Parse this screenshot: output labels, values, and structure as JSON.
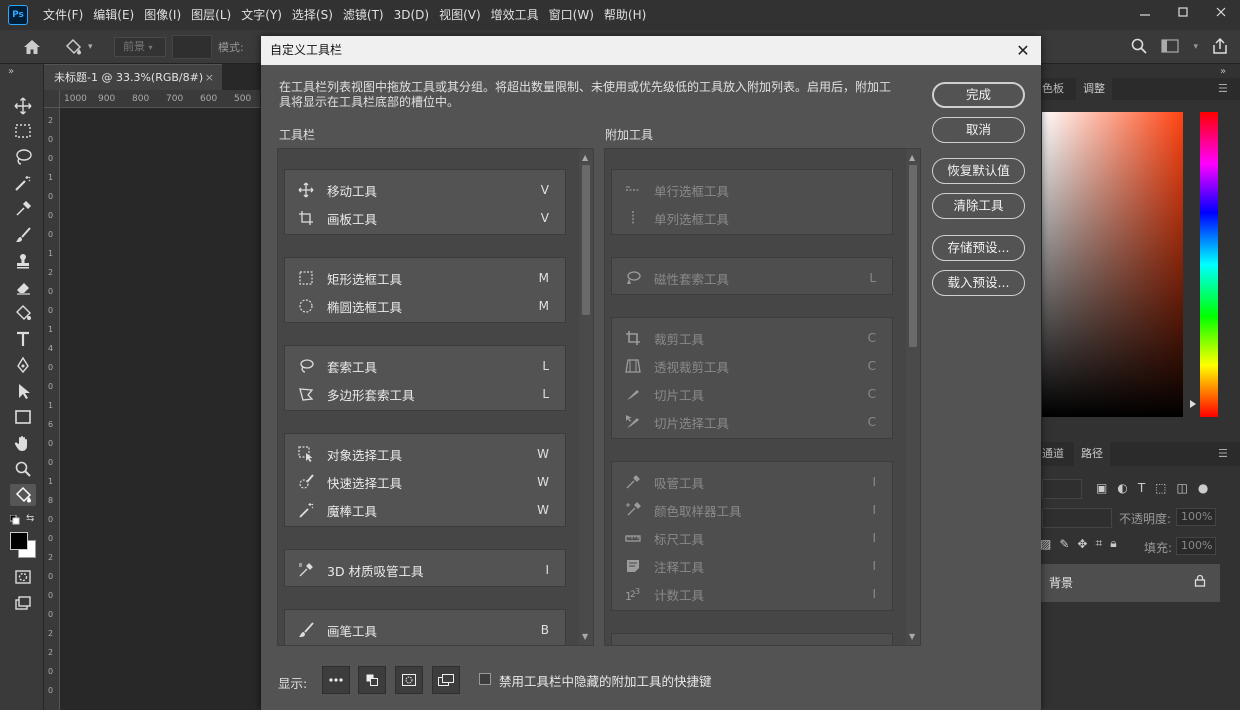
{
  "app": {
    "logo": "Ps",
    "menu": [
      "文件(F)",
      "编辑(E)",
      "图像(I)",
      "图层(L)",
      "文字(Y)",
      "选择(S)",
      "滤镜(T)",
      "3D(D)",
      "视图(V)",
      "增效工具",
      "窗口(W)",
      "帮助(H)"
    ]
  },
  "options_bar": {
    "fill_source": "前景",
    "mode_label": "模式:"
  },
  "document": {
    "tab_title": "未标题-1 @ 33.3%(RGB/8#)",
    "ruler_ticks": [
      "1000",
      "900",
      "800",
      "700",
      "600",
      "500"
    ],
    "vruler_ticks": [
      "2",
      "0",
      "0",
      "1",
      "0",
      "0",
      "0",
      "1",
      "2",
      "0",
      "0",
      "1",
      "4",
      "0",
      "0",
      "1",
      "6",
      "0",
      "0",
      "1",
      "8",
      "0",
      "0",
      "2",
      "0",
      "0",
      "0",
      "2",
      "2",
      "0",
      "0"
    ]
  },
  "panels": {
    "color_tab": "色板",
    "adjust_tab": "调整",
    "channels_tab": "通道",
    "paths_tab": "路径",
    "opacity_label": "不透明度:",
    "opacity_value": "100%",
    "fill_label": "填充:",
    "fill_value": "100%",
    "layer_name": "背景"
  },
  "dialog": {
    "title": "自定义工具栏",
    "description": "在工具栏列表视图中拖放工具或其分组。将超出数量限制、未使用或优先级低的工具放入附加列表。启用后，附加工具将显示在工具栏底部的槽位中。",
    "toolbar_label": "工具栏",
    "extra_label": "附加工具",
    "buttons": {
      "done": "完成",
      "cancel": "取消",
      "restore": "恢复默认值",
      "clear": "清除工具",
      "save_preset": "存储预设...",
      "load_preset": "载入预设..."
    },
    "show_label": "显示:",
    "checkbox_label": "禁用工具栏中隐藏的附加工具的快捷键",
    "toolbar_groups": [
      [
        {
          "name": "移动工具",
          "key": "V",
          "icon": "move-icon"
        },
        {
          "name": "画板工具",
          "key": "V",
          "icon": "artboard-icon"
        }
      ],
      [
        {
          "name": "矩形选框工具",
          "key": "M",
          "icon": "rect-marquee-icon"
        },
        {
          "name": "椭圆选框工具",
          "key": "M",
          "icon": "ellipse-marquee-icon"
        }
      ],
      [
        {
          "name": "套索工具",
          "key": "L",
          "icon": "lasso-icon"
        },
        {
          "name": "多边形套索工具",
          "key": "L",
          "icon": "polygon-lasso-icon"
        }
      ],
      [
        {
          "name": "对象选择工具",
          "key": "W",
          "icon": "object-select-icon"
        },
        {
          "name": "快速选择工具",
          "key": "W",
          "icon": "quick-select-icon"
        },
        {
          "name": "魔棒工具",
          "key": "W",
          "icon": "magic-wand-icon"
        }
      ],
      [
        {
          "name": "3D 材质吸管工具",
          "key": "I",
          "icon": "3d-eyedropper-icon"
        }
      ],
      [
        {
          "name": "画笔工具",
          "key": "B",
          "icon": "brush-icon"
        }
      ]
    ],
    "extra_groups": [
      [
        {
          "name": "单行选框工具",
          "key": "",
          "icon": "single-row-icon"
        },
        {
          "name": "单列选框工具",
          "key": "",
          "icon": "single-col-icon"
        }
      ],
      [
        {
          "name": "磁性套索工具",
          "key": "L",
          "icon": "magnetic-lasso-icon"
        }
      ],
      [
        {
          "name": "裁剪工具",
          "key": "C",
          "icon": "crop-icon"
        },
        {
          "name": "透视裁剪工具",
          "key": "C",
          "icon": "perspective-crop-icon"
        },
        {
          "name": "切片工具",
          "key": "C",
          "icon": "slice-icon"
        },
        {
          "name": "切片选择工具",
          "key": "C",
          "icon": "slice-select-icon"
        }
      ],
      [
        {
          "name": "吸管工具",
          "key": "I",
          "icon": "eyedropper-icon"
        },
        {
          "name": "颜色取样器工具",
          "key": "I",
          "icon": "color-sampler-icon"
        },
        {
          "name": "标尺工具",
          "key": "I",
          "icon": "ruler-icon"
        },
        {
          "name": "注释工具",
          "key": "I",
          "icon": "note-icon"
        },
        {
          "name": "计数工具",
          "key": "I",
          "icon": "count-icon"
        }
      ],
      [
        {
          "name": "",
          "key": "",
          "icon": "heal-icon"
        }
      ]
    ]
  }
}
